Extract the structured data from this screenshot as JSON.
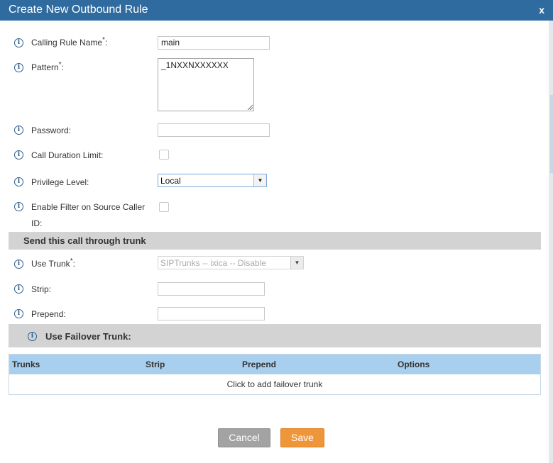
{
  "dialog": {
    "title": "Create New Outbound Rule",
    "close_label": "x"
  },
  "fields": {
    "calling_rule_name": {
      "label": "Calling Rule Name",
      "required_mark": "*",
      "suffix": ":",
      "value": "main"
    },
    "pattern": {
      "label": "Pattern",
      "required_mark": "*",
      "suffix": ":",
      "value": "_1NXXNXXXXXX"
    },
    "password": {
      "label": "Password:",
      "value": ""
    },
    "call_duration_limit": {
      "label": "Call Duration Limit:",
      "checked": false
    },
    "privilege_level": {
      "label": "Privilege Level:",
      "value": "Local"
    },
    "enable_filter": {
      "label_line1": "Enable Filter on Source Caller",
      "label_line2": "ID:",
      "checked": false
    }
  },
  "trunk_section": {
    "title": "Send this call through trunk",
    "use_trunk": {
      "label": "Use Trunk",
      "required_mark": "*",
      "suffix": ":",
      "value": "SIPTrunks -- ixica -- Disable"
    },
    "strip": {
      "label": "Strip:",
      "value": ""
    },
    "prepend": {
      "label": "Prepend:",
      "value": ""
    }
  },
  "failover": {
    "title": "Use Failover Trunk:",
    "columns": [
      "Trunks",
      "Strip",
      "Prepend",
      "Options"
    ],
    "add_label": "Click to add failover trunk"
  },
  "buttons": {
    "cancel": "Cancel",
    "save": "Save"
  },
  "colors": {
    "titlebar": "#2f6b9e",
    "section_bar": "#d3d3d3",
    "table_header": "#a9cfee",
    "cancel_button": "#a3a3a3",
    "save_button": "#f0963a",
    "info_icon": "#2a5d8f"
  },
  "icons": {
    "info": "info-circle-icon",
    "dropdown": "triangle-down-icon"
  }
}
